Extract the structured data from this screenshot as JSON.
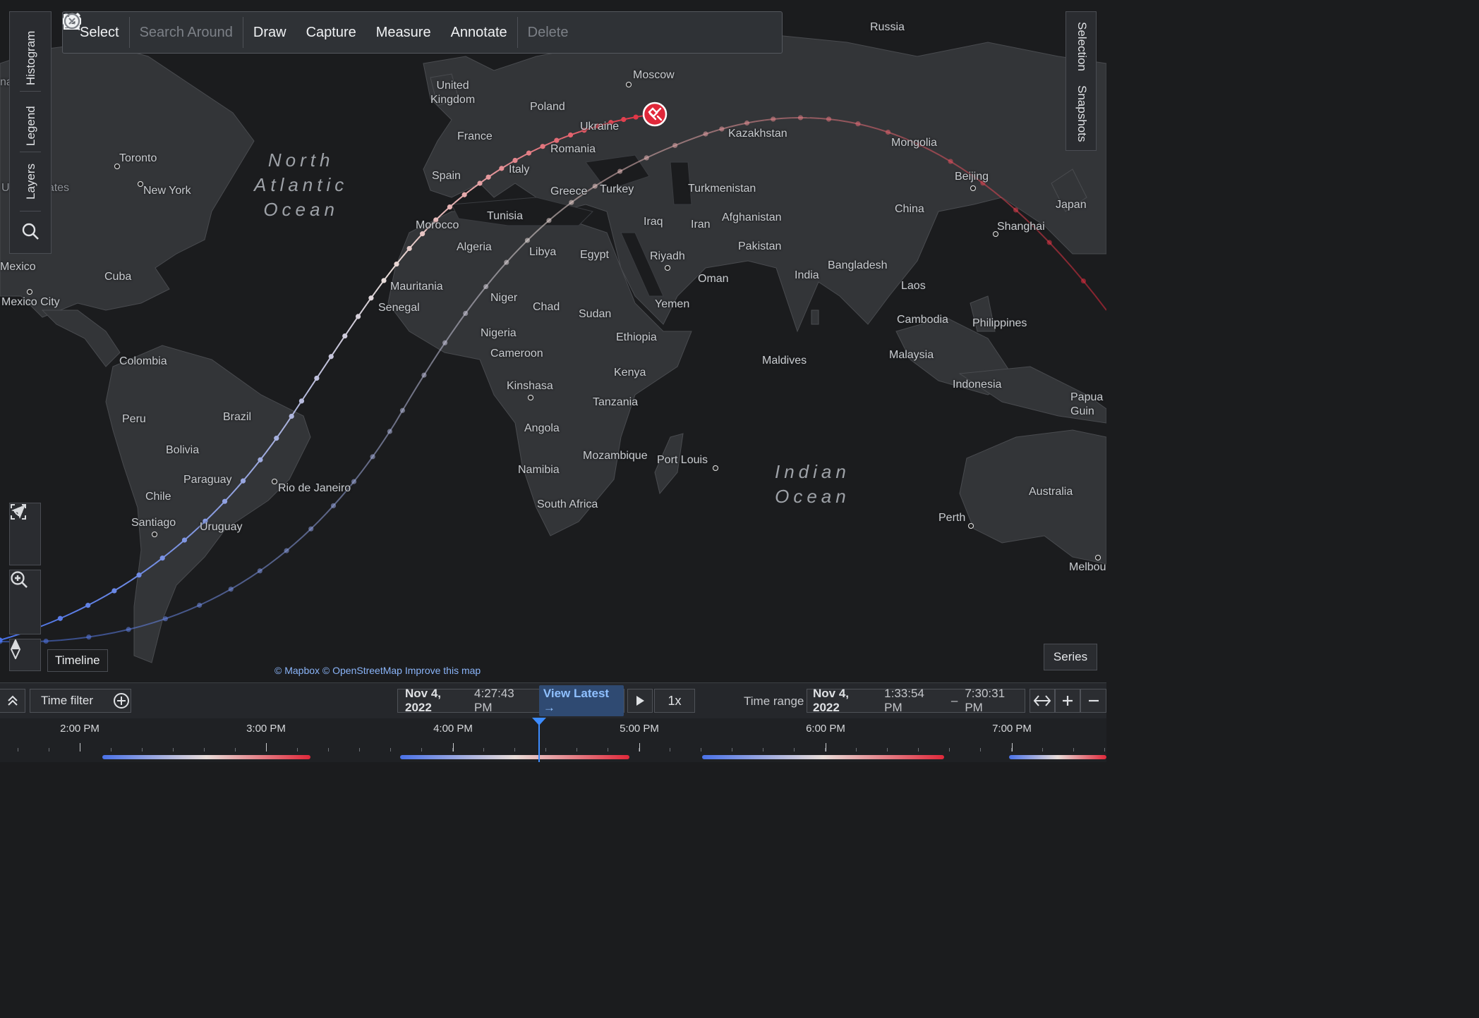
{
  "toolbar": {
    "select": "Select",
    "search_around": "Search Around",
    "draw": "Draw",
    "capture": "Capture",
    "measure": "Measure",
    "annotate": "Annotate",
    "delete": "Delete"
  },
  "left_tabs": {
    "histogram": "Histogram",
    "legend": "Legend",
    "layers": "Layers"
  },
  "right_tabs": {
    "selection": "Selection",
    "snapshots": "Snapshots"
  },
  "map": {
    "oceans": {
      "north_atlantic": "North\nAtlantic\nOcean",
      "indian": "Indian\nOcean"
    },
    "labels": {
      "russia": "Russia",
      "moscow": "Moscow",
      "uk": "United\nKingdom",
      "poland": "Poland",
      "ukraine": "Ukraine",
      "france": "France",
      "romania": "Romania",
      "kazakhstan": "Kazakhstan",
      "mongolia": "Mongolia",
      "spain": "Spain",
      "italy": "Italy",
      "greece": "Greece",
      "turkey": "Turkey",
      "turkmenistan": "Turkmenistan",
      "beijing": "Beijing",
      "japan": "Japan",
      "china": "China",
      "shanghai": "Shanghai",
      "iraq": "Iraq",
      "iran": "Iran",
      "afghanistan": "Afghanistan",
      "pakistan": "Pakistan",
      "morocco": "Morocco",
      "tunisia": "Tunisia",
      "algeria": "Algeria",
      "libya": "Libya",
      "egypt": "Egypt",
      "riyadh": "Riyadh",
      "oman": "Oman",
      "india": "India",
      "bangladesh": "Bangladesh",
      "laos": "Laos",
      "mauritania": "Mauritania",
      "senegal": "Senegal",
      "niger": "Niger",
      "chad": "Chad",
      "sudan": "Sudan",
      "yemen": "Yemen",
      "cambodia": "Cambodia",
      "philippines": "Philippines",
      "nigeria": "Nigeria",
      "ethiopia": "Ethiopia",
      "cameroon": "Cameroon",
      "maldives": "Maldives",
      "malaysia": "Malaysia",
      "kenya": "Kenya",
      "kinshasa": "Kinshasa",
      "indonesia": "Indonesia",
      "papua": "Papua\nGuin",
      "tanzania": "Tanzania",
      "angola": "Angola",
      "mozambique": "Mozambique",
      "port_louis": "Port Louis",
      "namibia": "Namibia",
      "south_africa": "South Africa",
      "australia": "Australia",
      "perth": "Perth",
      "melbourne": "Melbou",
      "toronto": "Toronto",
      "new_york": "New York",
      "united_states": "United States",
      "mexico": "Mexico",
      "cuba": "Cuba",
      "mexico_city": "Mexico City",
      "colombia": "Colombia",
      "brazil": "Brazil",
      "peru": "Peru",
      "bolivia": "Bolivia",
      "paraguay": "Paraguay",
      "chile": "Chile",
      "rio": "Rio de Janeiro",
      "santiago": "Santiago",
      "uruguay": "Uruguay",
      "canada": "nada"
    },
    "attribution": "© Mapbox © OpenStreetMap Improve this map",
    "timeline_label": "Timeline",
    "series_button": "Series"
  },
  "bottom": {
    "time_filter": "Time filter",
    "current_date": "Nov 4, 2022",
    "current_time": "4:27:43 PM",
    "view_latest": "View Latest →",
    "speed": "1x",
    "time_range_label": "Time range",
    "range_date": "Nov 4, 2022",
    "range_start": "1:33:54 PM",
    "range_dash": "–",
    "range_end": "7:30:31 PM",
    "ticks": [
      "2:00 PM",
      "3:00 PM",
      "4:00 PM",
      "5:00 PM",
      "6:00 PM",
      "7:00 PM"
    ]
  },
  "colors": {
    "track_start": "#4a72e8",
    "track_mid": "#e8dcd8",
    "track_end": "#e0283a",
    "accent": "#7fb2ff"
  }
}
